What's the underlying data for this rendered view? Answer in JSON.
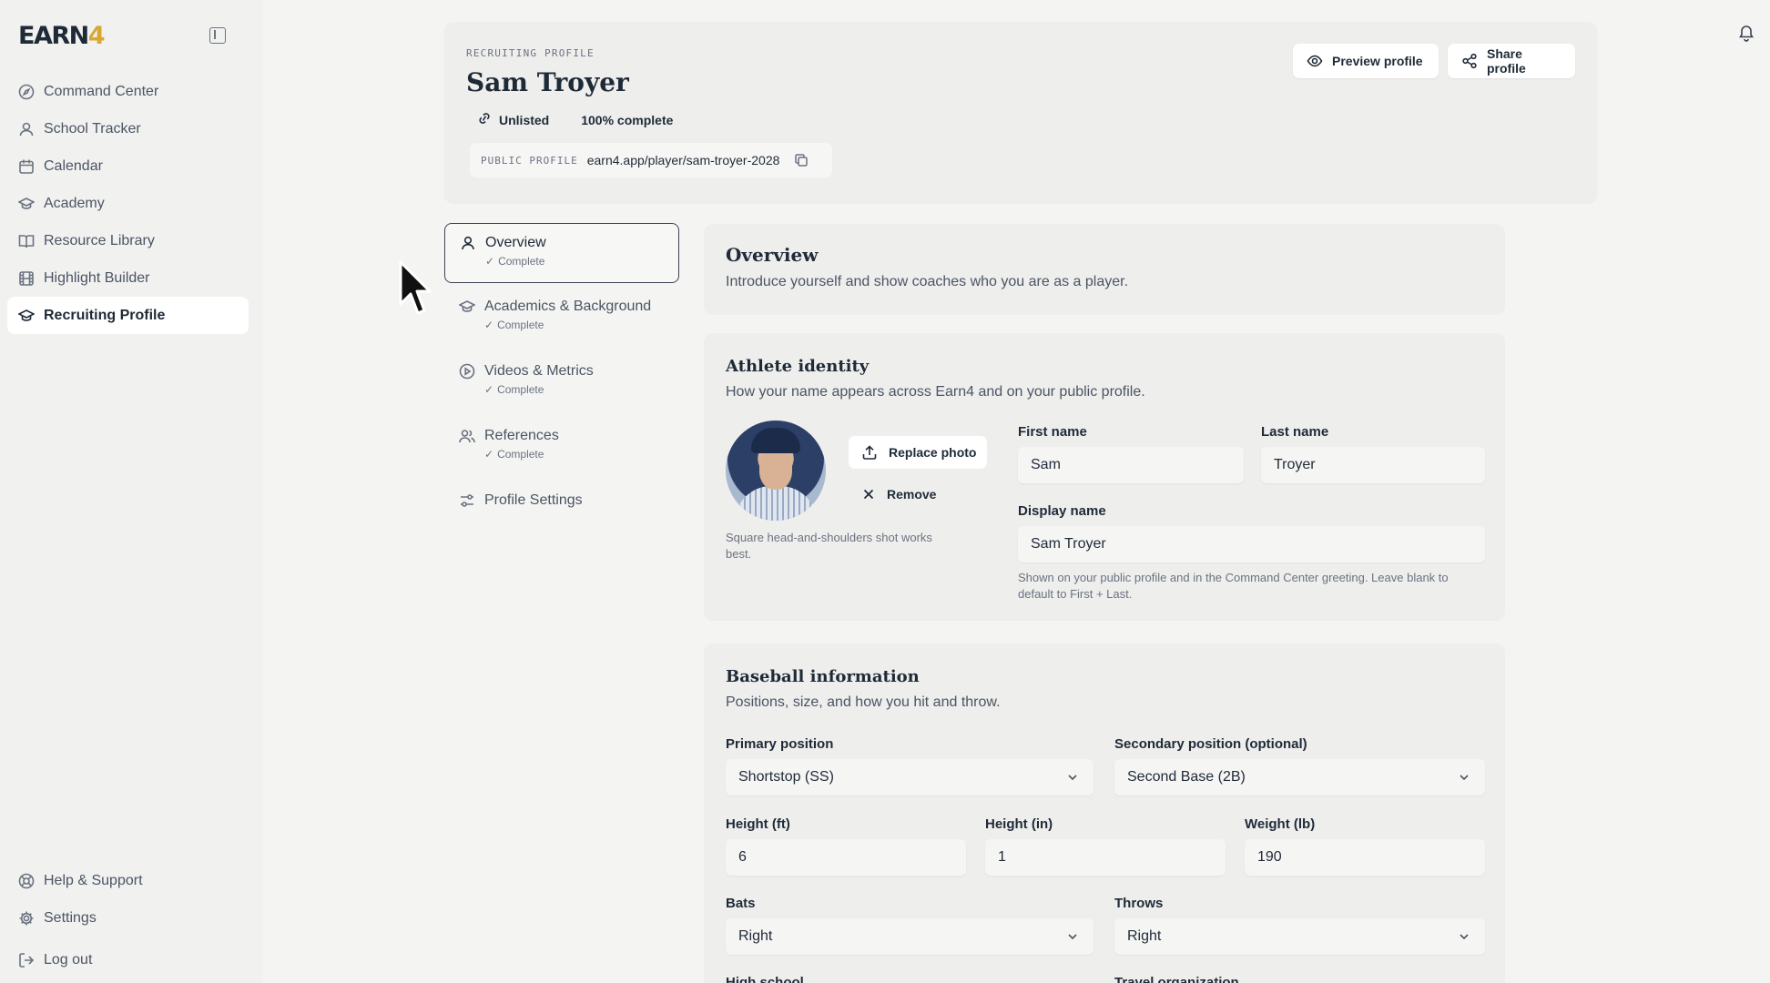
{
  "brand": {
    "logo_main": "EARN",
    "logo_accent": "4"
  },
  "sidebar": {
    "items": [
      {
        "label": "Command Center",
        "icon": "compass-icon"
      },
      {
        "label": "School Tracker",
        "icon": "user-icon"
      },
      {
        "label": "Calendar",
        "icon": "calendar-icon"
      },
      {
        "label": "Academy",
        "icon": "graduation-cap-icon"
      },
      {
        "label": "Resource Library",
        "icon": "book-icon"
      },
      {
        "label": "Highlight Builder",
        "icon": "film-icon"
      },
      {
        "label": "Recruiting Profile",
        "icon": "graduation-cap-icon",
        "active": true
      }
    ],
    "bottom": [
      {
        "label": "Help & Support",
        "icon": "lifebuoy-icon"
      },
      {
        "label": "Settings",
        "icon": "gear-icon"
      },
      {
        "label": "Log out",
        "icon": "logout-icon"
      }
    ]
  },
  "header": {
    "eyebrow": "RECRUITING PROFILE",
    "name": "Sam Troyer",
    "visibility": "Unlisted",
    "completion": "100% complete",
    "public_label": "PUBLIC PROFILE",
    "public_url": "earn4.app/player/sam-troyer-2028",
    "preview_label": "Preview profile",
    "share_label": "Share profile"
  },
  "sections": [
    {
      "label": "Overview",
      "status": "Complete",
      "icon": "user-icon",
      "active": true
    },
    {
      "label": "Academics & Background",
      "status": "Complete",
      "icon": "graduation-cap-icon"
    },
    {
      "label": "Videos & Metrics",
      "status": "Complete",
      "icon": "play-circle-icon"
    },
    {
      "label": "References",
      "status": "Complete",
      "icon": "users-icon"
    },
    {
      "label": "Profile Settings",
      "status": "",
      "icon": "sliders-icon"
    }
  ],
  "overview": {
    "title": "Overview",
    "description": "Introduce yourself and show coaches who you are as a player."
  },
  "identity": {
    "title": "Athlete identity",
    "description": "How your name appears across Earn4 and on your public profile.",
    "replace_label": "Replace photo",
    "remove_label": "Remove",
    "photo_help": "Square head-and-shoulders shot works best.",
    "first_name_label": "First name",
    "first_name": "Sam",
    "last_name_label": "Last name",
    "last_name": "Troyer",
    "display_name_label": "Display name",
    "display_name": "Sam Troyer",
    "display_help": "Shown on your public profile and in the Command Center greeting. Leave blank to default to First + Last."
  },
  "baseball": {
    "title": "Baseball information",
    "description": "Positions, size, and how you hit and throw.",
    "primary_label": "Primary position",
    "primary_value": "Shortstop (SS)",
    "secondary_label": "Secondary position (optional)",
    "secondary_value": "Second Base (2B)",
    "height_ft_label": "Height (ft)",
    "height_ft": "6",
    "height_in_label": "Height (in)",
    "height_in": "1",
    "weight_label": "Weight (lb)",
    "weight": "190",
    "bats_label": "Bats",
    "bats": "Right",
    "throws_label": "Throws",
    "throws": "Right",
    "high_school_label": "High school",
    "travel_org_label": "Travel organization"
  },
  "colors": {
    "accent": "#d9a830",
    "text": "#1f2a37",
    "muted": "#6b7280",
    "card": "#eeeeed"
  }
}
